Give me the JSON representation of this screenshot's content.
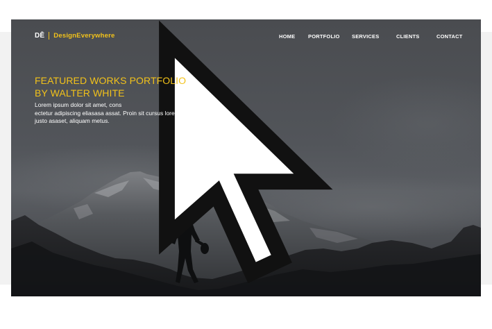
{
  "brand": {
    "logo_mark": "DĒ",
    "name": "DesignEverywhere",
    "accent": "#f2c21a"
  },
  "nav": {
    "items": [
      "HOME",
      "PORTFOLIO",
      "SERVICES",
      "CLIENTS",
      "CONTACT"
    ]
  },
  "hero": {
    "title_lines": [
      "FEATURED WORKS PORTFOLIO",
      " BY WALTER WHITE"
    ],
    "body_lines": [
      "Lorem ipsum dolor sit amet, cons",
      "ectetur adipiscing eliasasa assat. Proin sit cursus loren",
      "justo asaset, aliquam metus."
    ],
    "background": "mountain-silhouette-image"
  },
  "colors": {
    "overlay": "#4a4d52",
    "title": "#f2c21a",
    "text": "#ffffff"
  }
}
